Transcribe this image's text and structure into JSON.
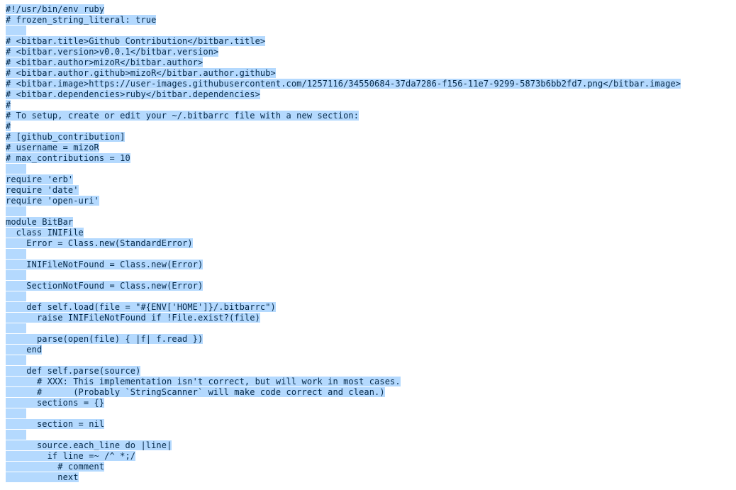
{
  "code_lines": [
    "#!/usr/bin/env ruby",
    "# frozen_string_literal: true",
    "",
    "# <bitbar.title>Github Contribution</bitbar.title>",
    "# <bitbar.version>v0.0.1</bitbar.version>",
    "# <bitbar.author>mizoR</bitbar.author>",
    "# <bitbar.author.github>mizoR</bitbar.author.github>",
    "# <bitbar.image>https://user-images.githubusercontent.com/1257116/34550684-37da7286-f156-11e7-9299-5873b6bb2fd7.png</bitbar.image>",
    "# <bitbar.dependencies>ruby</bitbar.dependencies>",
    "#",
    "# To setup, create or edit your ~/.bitbarrc file with a new section:",
    "#",
    "# [github_contribution]",
    "# username = mizoR",
    "# max_contributions = 10",
    "",
    "require 'erb'",
    "require 'date'",
    "require 'open-uri'",
    "",
    "module BitBar",
    "  class INIFile",
    "    Error = Class.new(StandardError)",
    "",
    "    INIFileNotFound = Class.new(Error)",
    "",
    "    SectionNotFound = Class.new(Error)",
    "",
    "    def self.load(file = \"#{ENV['HOME']}/.bitbarrc\")",
    "      raise INIFileNotFound if !File.exist?(file)",
    "",
    "      parse(open(file) { |f| f.read })",
    "    end",
    "",
    "    def self.parse(source)",
    "      # XXX: This implementation isn't correct, but will work in most cases.",
    "      #      (Probably `StringScanner` will make code correct and clean.)",
    "      sections = {}",
    "",
    "      section = nil",
    "",
    "      source.each_line do |line|",
    "        if line =~ /^ *;/",
    "          # comment",
    "          next"
  ]
}
